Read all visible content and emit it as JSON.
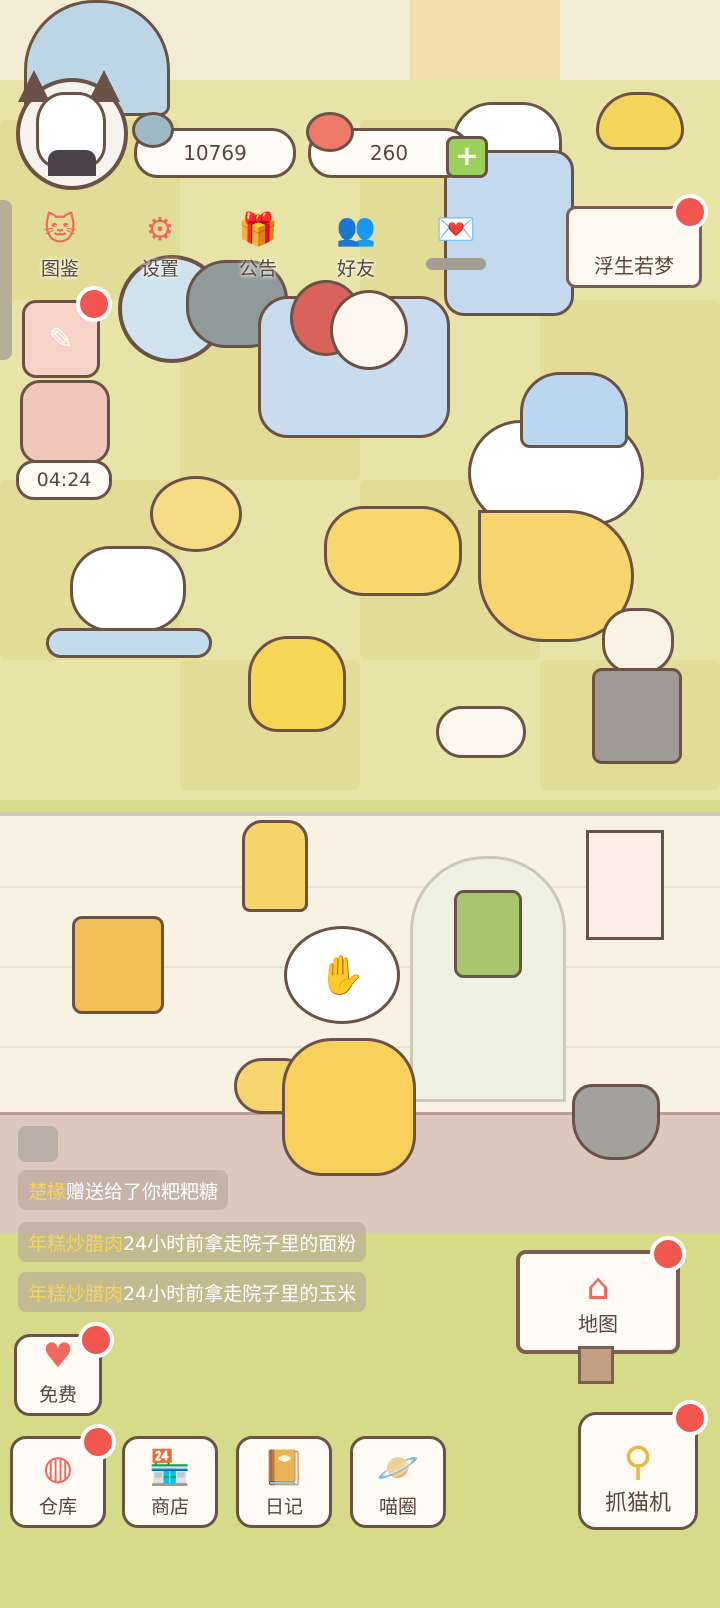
{
  "top_bar": {
    "fish_count": "10769",
    "heart_count": "260",
    "nav": [
      {
        "label": "图鉴",
        "icon": "cat-book-icon"
      },
      {
        "label": "设置",
        "icon": "gear-icon"
      },
      {
        "label": "公告",
        "icon": "gift-icon"
      },
      {
        "label": "好友",
        "icon": "friends-icon"
      },
      {
        "label": "",
        "icon": "mail-heart-icon"
      }
    ],
    "event_tag": "浮生若梦"
  },
  "side": {
    "timer": "04:24"
  },
  "feed": [
    {
      "name": "楚椽",
      "text": "赠送给了你粑粑糖"
    },
    {
      "name": "年糕炒腊肉",
      "text": "24小时前拿走院子里的面粉"
    },
    {
      "name": "年糕炒腊肉",
      "text": "24小时前拿走院子里的玉米"
    }
  ],
  "bottom": {
    "free_label": "免费",
    "warehouse_label": "仓库",
    "shop_label": "商店",
    "diary_label": "日记",
    "circle_label": "喵圈",
    "map_label": "地图",
    "claw_label": "抓猫机"
  },
  "colors": {
    "accent_red": "#f2574f",
    "outline": "#6b5246",
    "floor": "#e8e3a6",
    "grass": "#d6db8a"
  }
}
